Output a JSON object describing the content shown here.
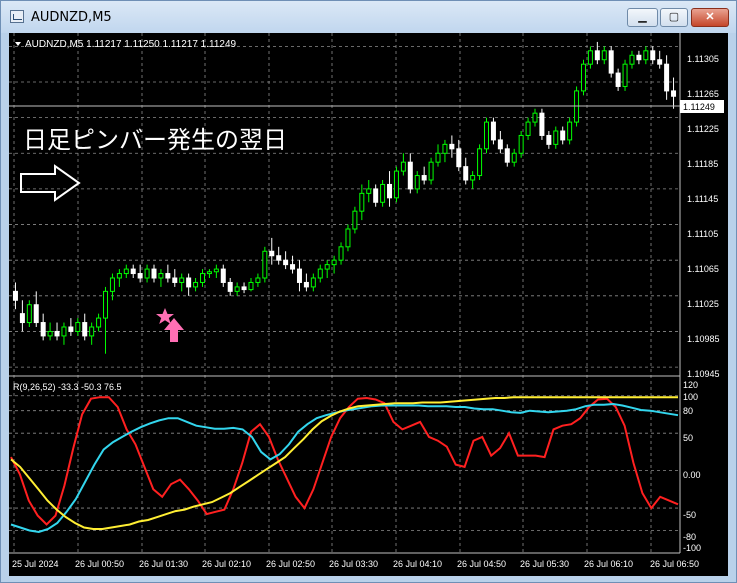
{
  "window": {
    "title": "AUDNZD,M5",
    "minimize_label": "▁",
    "maximize_label": "▢",
    "close_label": "✕"
  },
  "chart": {
    "header": "AUDNZD,M5  1.11217 1.11250 1.11217 1.11249",
    "annotation_text": "日足ピンバー発生の翌日",
    "current_price_label": "1.11249",
    "price_ticks": [
      "1.11305",
      "1.11265",
      "1.11225",
      "1.11185",
      "1.11145",
      "1.11105",
      "1.11065",
      "1.11025",
      "1.10985",
      "1.10945"
    ],
    "indicator_header": "R(9,26,52) -33.3 -50.3 76.5",
    "indicator_ticks": [
      "120",
      "100",
      "80",
      "50",
      "0.00",
      "-50",
      "-80",
      "-100"
    ],
    "time_ticks": [
      "25 Jul 2024",
      "26 Jul 00:50",
      "26 Jul 01:30",
      "26 Jul 02:10",
      "26 Jul 02:50",
      "26 Jul 03:30",
      "26 Jul 04:10",
      "26 Jul 04:50",
      "26 Jul 05:30",
      "26 Jul 06:10",
      "26 Jul 06:50"
    ],
    "markers": [
      "pink-star",
      "pink-up-arrow",
      "white-right-arrow"
    ],
    "colors": {
      "background": "#000000",
      "bull_candle": "#00ff00",
      "bear_candle": "#ffffff",
      "grid": "#8c8c8c",
      "red_line": "#ff2020",
      "cyan_line": "#33d6ee",
      "yellow_line": "#ffee33",
      "marker_pink": "#ff6fb4"
    }
  },
  "chart_data": {
    "type": "candlestick",
    "symbol": "AUDNZD",
    "timeframe": "M5",
    "ohlc_last": {
      "open": 1.11217,
      "high": 1.1125,
      "low": 1.11217,
      "close": 1.11249
    },
    "price_range": [
      1.10935,
      1.1132
    ],
    "candles": [
      [
        1.1103,
        1.1104,
        1.1101,
        1.1102
      ],
      [
        1.11005,
        1.1102,
        1.10985,
        1.10995
      ],
      [
        1.10995,
        1.1102,
        1.1099,
        1.11015
      ],
      [
        1.11015,
        1.1103,
        1.1099,
        1.10995
      ],
      [
        1.10995,
        1.11005,
        1.10975,
        1.1098
      ],
      [
        1.1098,
        1.10995,
        1.10975,
        1.10985
      ],
      [
        1.10985,
        1.10995,
        1.10975,
        1.1098
      ],
      [
        1.1098,
        1.10995,
        1.1097,
        1.1099
      ],
      [
        1.1099,
        1.11,
        1.1098,
        1.10985
      ],
      [
        1.10985,
        1.11,
        1.1098,
        1.10995
      ],
      [
        1.10995,
        1.11005,
        1.10975,
        1.1098
      ],
      [
        1.1098,
        1.10995,
        1.1097,
        1.1099
      ],
      [
        1.1099,
        1.11005,
        1.10985,
        1.11
      ],
      [
        1.11,
        1.11035,
        1.1096,
        1.1103
      ],
      [
        1.1103,
        1.1105,
        1.1102,
        1.11045
      ],
      [
        1.11045,
        1.11055,
        1.11035,
        1.1105
      ],
      [
        1.1105,
        1.1106,
        1.11045,
        1.11055
      ],
      [
        1.11055,
        1.1106,
        1.11045,
        1.1105
      ],
      [
        1.1105,
        1.1106,
        1.1104,
        1.11045
      ],
      [
        1.11045,
        1.1106,
        1.1104,
        1.11055
      ],
      [
        1.11055,
        1.1106,
        1.1104,
        1.11045
      ],
      [
        1.11045,
        1.11055,
        1.11035,
        1.1105
      ],
      [
        1.1105,
        1.1106,
        1.1104,
        1.11045
      ],
      [
        1.11045,
        1.11055,
        1.11035,
        1.1104
      ],
      [
        1.1104,
        1.1105,
        1.1103,
        1.11045
      ],
      [
        1.11045,
        1.1105,
        1.11025,
        1.11035
      ],
      [
        1.11035,
        1.11045,
        1.1103,
        1.1104
      ],
      [
        1.1104,
        1.11055,
        1.11035,
        1.1105
      ],
      [
        1.1105,
        1.11055,
        1.11045,
        1.11052
      ],
      [
        1.11052,
        1.1106,
        1.11045,
        1.11055
      ],
      [
        1.11055,
        1.1106,
        1.11035,
        1.1104
      ],
      [
        1.1104,
        1.11045,
        1.11025,
        1.1103
      ],
      [
        1.1103,
        1.1104,
        1.11025,
        1.11035
      ],
      [
        1.11035,
        1.1104,
        1.11028,
        1.11032
      ],
      [
        1.11032,
        1.11045,
        1.1103,
        1.1104
      ],
      [
        1.1104,
        1.1105,
        1.11035,
        1.11045
      ],
      [
        1.11045,
        1.1108,
        1.1104,
        1.11075
      ],
      [
        1.11075,
        1.1109,
        1.1106,
        1.1107
      ],
      [
        1.1107,
        1.1108,
        1.1106,
        1.11065
      ],
      [
        1.11065,
        1.11075,
        1.11055,
        1.1106
      ],
      [
        1.1106,
        1.1107,
        1.1105,
        1.11055
      ],
      [
        1.11055,
        1.11065,
        1.1103,
        1.1104
      ],
      [
        1.1104,
        1.1105,
        1.1103,
        1.11035
      ],
      [
        1.11035,
        1.1105,
        1.1103,
        1.11045
      ],
      [
        1.11045,
        1.1106,
        1.1104,
        1.11055
      ],
      [
        1.11055,
        1.11065,
        1.11045,
        1.1106
      ],
      [
        1.1106,
        1.1107,
        1.1105,
        1.11065
      ],
      [
        1.11065,
        1.11085,
        1.1106,
        1.1108
      ],
      [
        1.1108,
        1.11105,
        1.11075,
        1.111
      ],
      [
        1.111,
        1.11125,
        1.11095,
        1.1112
      ],
      [
        1.1112,
        1.1115,
        1.1111,
        1.1114
      ],
      [
        1.1114,
        1.11155,
        1.1113,
        1.11145
      ],
      [
        1.11145,
        1.1115,
        1.11125,
        1.1113
      ],
      [
        1.1113,
        1.11155,
        1.11125,
        1.1115
      ],
      [
        1.1115,
        1.11165,
        1.11125,
        1.11135
      ],
      [
        1.11135,
        1.1117,
        1.1113,
        1.11165
      ],
      [
        1.11165,
        1.11185,
        1.1116,
        1.11175
      ],
      [
        1.11175,
        1.11185,
        1.1114,
        1.11145
      ],
      [
        1.11145,
        1.11165,
        1.1114,
        1.1116
      ],
      [
        1.1116,
        1.1117,
        1.1115,
        1.11155
      ],
      [
        1.11155,
        1.1118,
        1.1115,
        1.11175
      ],
      [
        1.11175,
        1.11195,
        1.1117,
        1.11185
      ],
      [
        1.11185,
        1.112,
        1.11175,
        1.11195
      ],
      [
        1.11195,
        1.11205,
        1.1118,
        1.1119
      ],
      [
        1.1119,
        1.112,
        1.11165,
        1.1117
      ],
      [
        1.1117,
        1.1118,
        1.1115,
        1.11155
      ],
      [
        1.11155,
        1.11165,
        1.11145,
        1.1116
      ],
      [
        1.1116,
        1.11195,
        1.11155,
        1.1119
      ],
      [
        1.1119,
        1.11225,
        1.11185,
        1.1122
      ],
      [
        1.1122,
        1.11225,
        1.11195,
        1.112
      ],
      [
        1.112,
        1.1121,
        1.11185,
        1.1119
      ],
      [
        1.1119,
        1.11195,
        1.1117,
        1.11175
      ],
      [
        1.11175,
        1.1119,
        1.1117,
        1.11185
      ],
      [
        1.11185,
        1.1121,
        1.1118,
        1.11205
      ],
      [
        1.11205,
        1.11225,
        1.112,
        1.1122
      ],
      [
        1.1122,
        1.11235,
        1.11215,
        1.1123
      ],
      [
        1.1123,
        1.11235,
        1.112,
        1.11205
      ],
      [
        1.11205,
        1.1121,
        1.1119,
        1.11195
      ],
      [
        1.11195,
        1.11215,
        1.1119,
        1.1121
      ],
      [
        1.1121,
        1.11215,
        1.11195,
        1.112
      ],
      [
        1.112,
        1.11225,
        1.11195,
        1.1122
      ],
      [
        1.1122,
        1.1126,
        1.11215,
        1.11255
      ],
      [
        1.11255,
        1.1129,
        1.1125,
        1.11285
      ],
      [
        1.11285,
        1.11305,
        1.1128,
        1.113
      ],
      [
        1.113,
        1.1131,
        1.11285,
        1.1129
      ],
      [
        1.1129,
        1.11305,
        1.11285,
        1.113
      ],
      [
        1.113,
        1.11305,
        1.1127,
        1.11275
      ],
      [
        1.11275,
        1.1128,
        1.11255,
        1.1126
      ],
      [
        1.1126,
        1.1129,
        1.11255,
        1.11285
      ],
      [
        1.11285,
        1.113,
        1.1128,
        1.11295
      ],
      [
        1.11295,
        1.113,
        1.11285,
        1.1129
      ],
      [
        1.1129,
        1.11305,
        1.11285,
        1.113
      ],
      [
        1.113,
        1.11305,
        1.11285,
        1.1129
      ],
      [
        1.1129,
        1.113,
        1.1128,
        1.11285
      ],
      [
        1.11285,
        1.11295,
        1.11245,
        1.11255
      ],
      [
        1.11255,
        1.1127,
        1.11235,
        1.11249
      ]
    ],
    "indicator": {
      "name": "R(9,26,52)",
      "values": [
        -33.3,
        -50.3,
        76.5
      ],
      "ylim": [
        -110,
        125
      ],
      "series": [
        {
          "name": "R9",
          "color": "#ff2020",
          "values": [
            18,
            -5,
            -40,
            -60,
            -72,
            -60,
            -20,
            30,
            75,
            96,
            98,
            98,
            85,
            55,
            35,
            5,
            -25,
            -35,
            -18,
            -12,
            -25,
            -40,
            -58,
            -55,
            -52,
            -25,
            10,
            52,
            62,
            45,
            15,
            -10,
            -35,
            -50,
            -25,
            10,
            45,
            70,
            85,
            96,
            97,
            95,
            90,
            65,
            55,
            60,
            65,
            45,
            40,
            32,
            8,
            5,
            40,
            45,
            20,
            30,
            50,
            20,
            20,
            20,
            18,
            55,
            60,
            62,
            70,
            85,
            95,
            96,
            85,
            60,
            10,
            -30,
            -50,
            -35,
            -40,
            -45
          ]
        },
        {
          "name": "R26",
          "color": "#33d6ee",
          "values": [
            -72,
            -76,
            -80,
            -82,
            -78,
            -70,
            -55,
            -38,
            -15,
            8,
            28,
            38,
            45,
            52,
            58,
            63,
            67,
            70,
            70,
            65,
            60,
            58,
            56,
            56,
            57,
            55,
            45,
            25,
            15,
            22,
            35,
            52,
            62,
            70,
            74,
            77,
            80,
            82,
            84,
            86,
            87,
            87,
            87,
            87,
            87,
            86,
            86,
            86,
            85,
            85,
            83,
            82,
            82,
            80,
            78,
            77,
            80,
            79,
            78,
            79,
            80,
            82,
            86,
            88,
            88,
            89,
            87,
            84,
            81,
            80,
            78,
            76,
            74
          ]
        },
        {
          "name": "R52",
          "color": "#ffee33",
          "values": [
            15,
            5,
            -10,
            -25,
            -40,
            -52,
            -62,
            -70,
            -76,
            -78,
            -78,
            -76,
            -74,
            -72,
            -68,
            -66,
            -62,
            -58,
            -54,
            -52,
            -48,
            -45,
            -42,
            -36,
            -30,
            -22,
            -14,
            -6,
            2,
            10,
            18,
            30,
            42,
            55,
            66,
            73,
            79,
            83,
            86,
            87,
            88,
            89,
            90,
            90,
            90,
            91,
            91,
            91,
            92,
            93,
            94,
            95,
            96,
            97,
            97,
            98,
            98,
            98,
            98,
            98,
            98,
            98,
            98,
            98,
            98,
            98,
            98,
            98,
            98,
            98,
            98,
            98,
            98,
            98
          ]
        }
      ]
    },
    "x_ticks": [
      "25 Jul 2024",
      "26 Jul 00:50",
      "26 Jul 01:30",
      "26 Jul 02:10",
      "26 Jul 02:50",
      "26 Jul 03:30",
      "26 Jul 04:10",
      "26 Jul 04:50",
      "26 Jul 05:30",
      "26 Jul 06:10",
      "26 Jul 06:50"
    ]
  }
}
